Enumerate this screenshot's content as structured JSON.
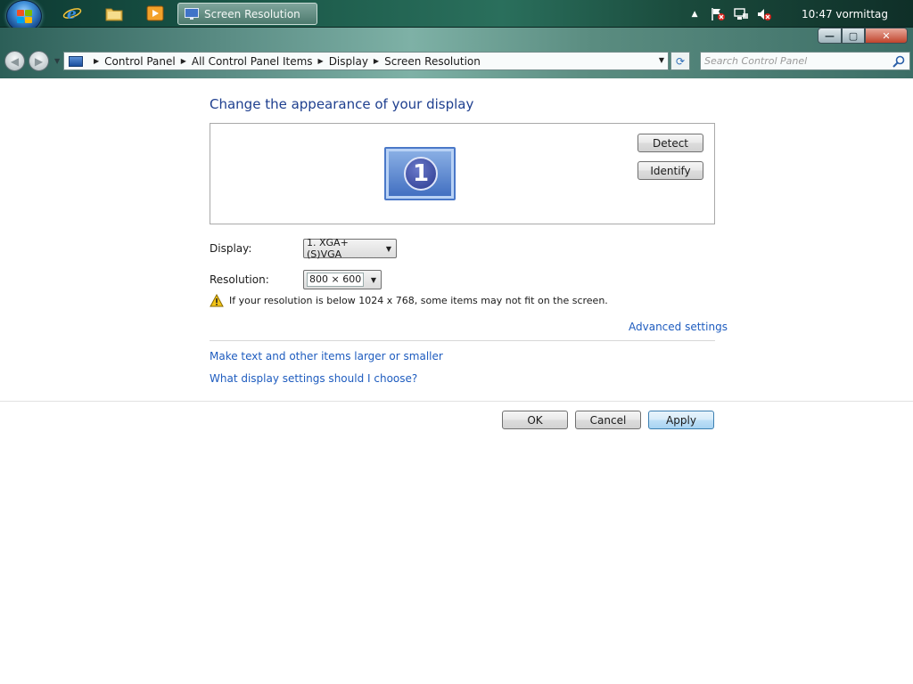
{
  "taskbar": {
    "task_title": "Screen Resolution",
    "clock": "10:47 vormittag"
  },
  "window": {
    "minimize_glyph": "—",
    "maximize_glyph": "▢",
    "close_glyph": "✕"
  },
  "address": {
    "crumbs": [
      "Control Panel",
      "All Control Panel Items",
      "Display",
      "Screen Resolution"
    ],
    "search_placeholder": "Search Control Panel"
  },
  "main": {
    "title": "Change the appearance of your display",
    "detect_label": "Detect",
    "identify_label": "Identify",
    "monitor_number": "1",
    "display_label": "Display:",
    "display_value": "1. XGA+(S)VGA",
    "resolution_label": "Resolution:",
    "resolution_value": "800 × 600",
    "warning_text": "If your resolution is below 1024 x 768, some items may not fit on the screen.",
    "advanced_link": "Advanced settings",
    "text_size_link": "Make text and other items larger or smaller",
    "help_link": "What display settings should I choose?"
  },
  "footer": {
    "ok_label": "OK",
    "cancel_label": "Cancel",
    "apply_label": "Apply"
  },
  "colors": {
    "link": "#1e5cbf",
    "title": "#1e3f8f",
    "taskbar": "#1c5a4a"
  }
}
